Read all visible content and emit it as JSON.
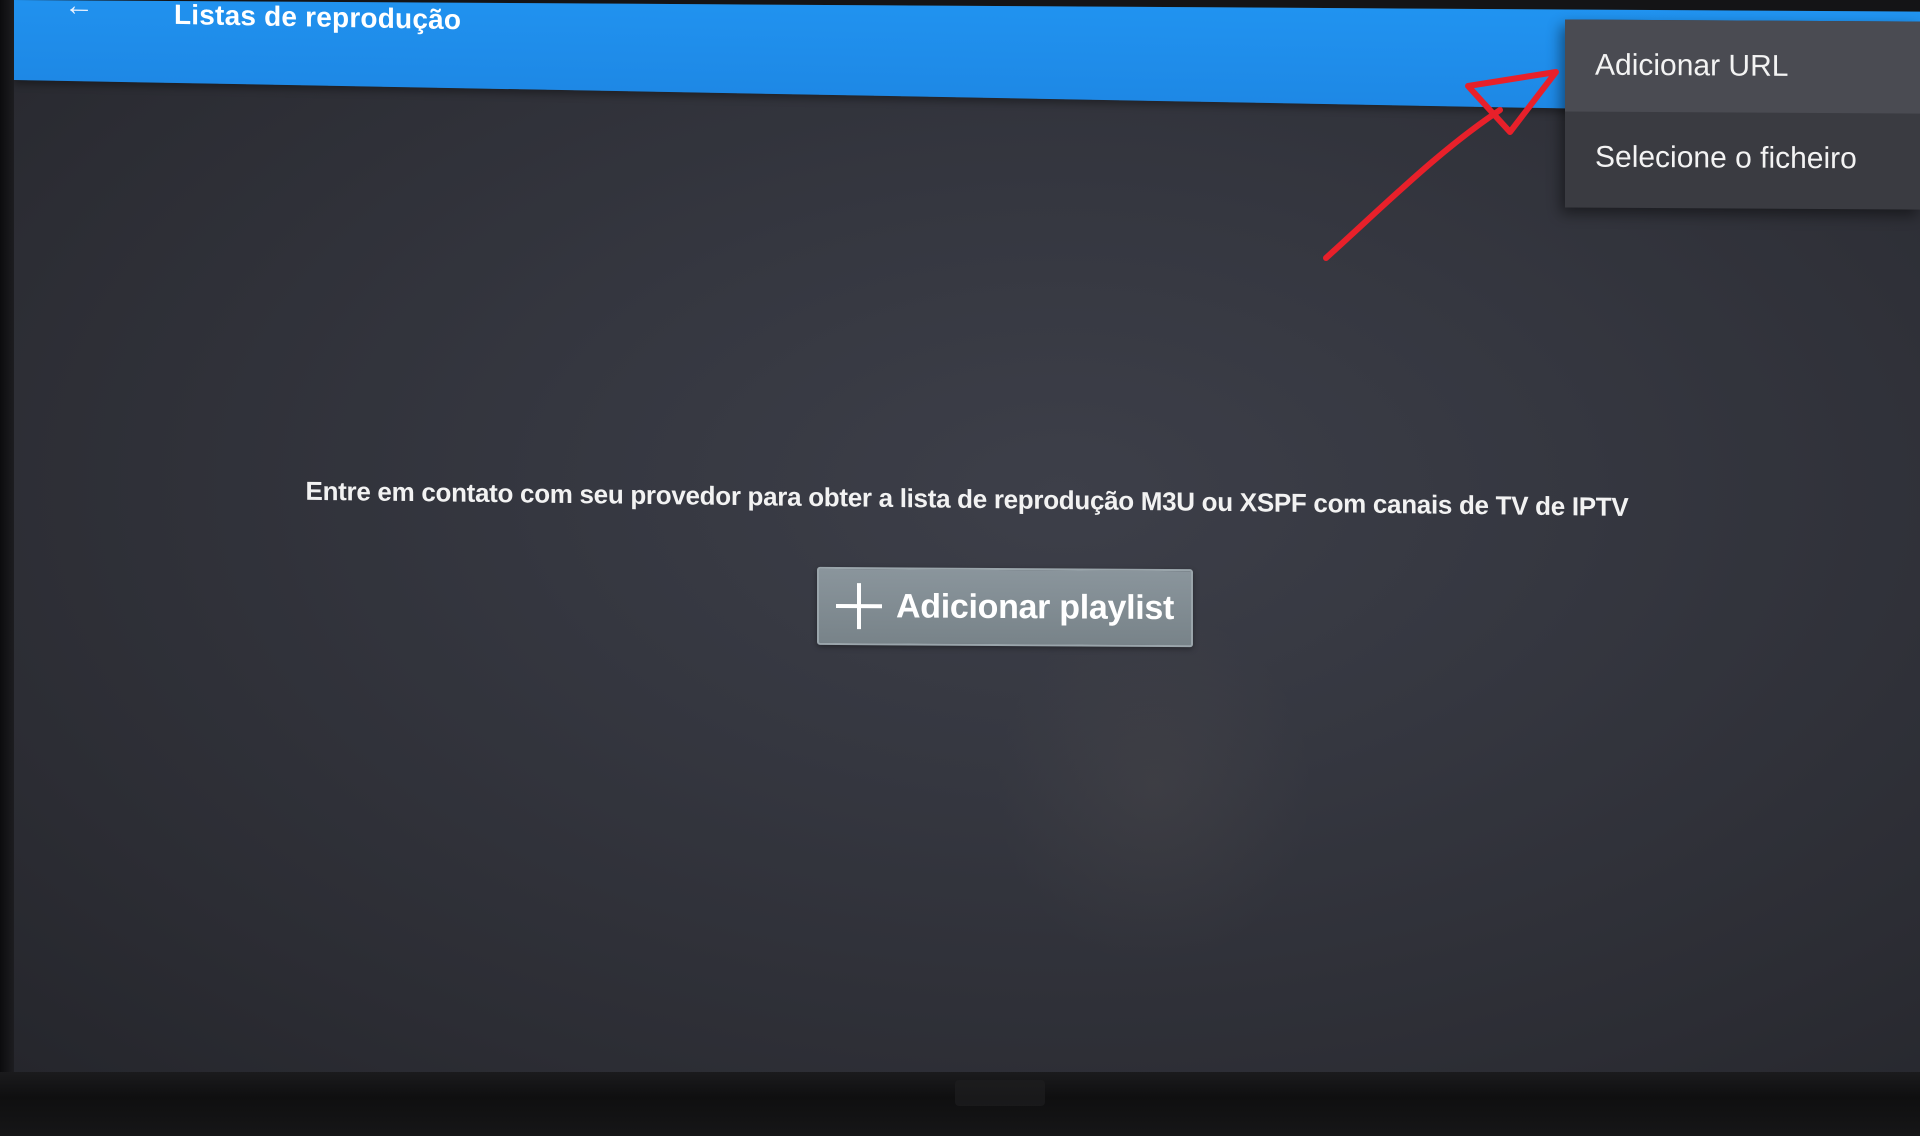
{
  "appbar": {
    "title": "Listas de reprodução",
    "back_icon": "arrow-left-icon",
    "color": "#2196f3"
  },
  "menu": {
    "items": [
      {
        "label": "Adicionar URL"
      },
      {
        "label": "Selecione o ficheiro"
      }
    ]
  },
  "main": {
    "message": "Entre em contato com seu provedor para obter a lista de reprodução M3U ou XSPF com canais de TV de IPTV",
    "add_button": {
      "label": "Adicionar playlist",
      "icon": "plus-icon"
    }
  },
  "annotation": {
    "arrow_color": "#e8202a",
    "arrow_icon": "red-arrow-annotation"
  }
}
